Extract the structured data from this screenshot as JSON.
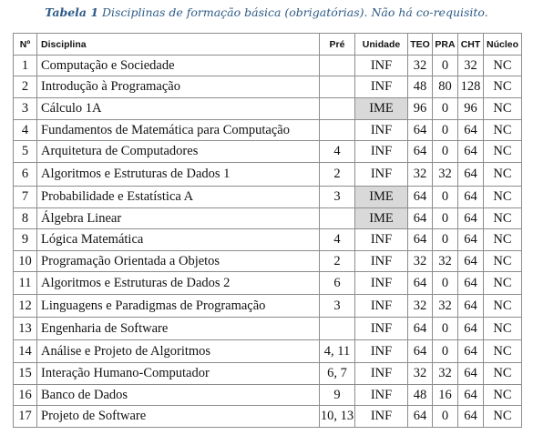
{
  "caption": {
    "label": "Tabela 1",
    "text": " Disciplinas de formação básica (obrigatórias). Não há co-requisito."
  },
  "table": {
    "headers": [
      "Nº",
      "Disciplina",
      "Pré",
      "Unidade",
      "TEO",
      "PRA",
      "CHT",
      "Núcleo"
    ],
    "rows": [
      {
        "n": "1",
        "disciplina": "Computação e Sociedade",
        "pre": "",
        "unidade": "INF",
        "teo": "32",
        "pra": "0",
        "cht": "32",
        "nucleo": "NC",
        "highlight": false
      },
      {
        "n": "2",
        "disciplina": "Introdução à Programação",
        "pre": "",
        "unidade": "INF",
        "teo": "48",
        "pra": "80",
        "cht": "128",
        "nucleo": "NC",
        "highlight": false
      },
      {
        "n": "3",
        "disciplina": "Cálculo 1A",
        "pre": "",
        "unidade": "IME",
        "teo": "96",
        "pra": "0",
        "cht": "96",
        "nucleo": "NC",
        "highlight": true
      },
      {
        "n": "4",
        "disciplina": "Fundamentos de Matemática para Computação",
        "pre": "",
        "unidade": "INF",
        "teo": "64",
        "pra": "0",
        "cht": "64",
        "nucleo": "NC",
        "highlight": false
      },
      {
        "n": "5",
        "disciplina": "Arquitetura de Computadores",
        "pre": "4",
        "unidade": "INF",
        "teo": "64",
        "pra": "0",
        "cht": "64",
        "nucleo": "NC",
        "highlight": false
      },
      {
        "n": "6",
        "disciplina": "Algoritmos e Estruturas de Dados 1",
        "pre": "2",
        "unidade": "INF",
        "teo": "32",
        "pra": "32",
        "cht": "64",
        "nucleo": "NC",
        "highlight": false
      },
      {
        "n": "7",
        "disciplina": "Probabilidade e Estatística A",
        "pre": "3",
        "unidade": "IME",
        "teo": "64",
        "pra": "0",
        "cht": "64",
        "nucleo": "NC",
        "highlight": true
      },
      {
        "n": "8",
        "disciplina": "Álgebra Linear",
        "pre": "",
        "unidade": "IME",
        "teo": "64",
        "pra": "0",
        "cht": "64",
        "nucleo": "NC",
        "highlight": true
      },
      {
        "n": "9",
        "disciplina": "Lógica Matemática",
        "pre": "4",
        "unidade": "INF",
        "teo": "64",
        "pra": "0",
        "cht": "64",
        "nucleo": "NC",
        "highlight": false
      },
      {
        "n": "10",
        "disciplina": "Programação Orientada a Objetos",
        "pre": "2",
        "unidade": "INF",
        "teo": "32",
        "pra": "32",
        "cht": "64",
        "nucleo": "NC",
        "highlight": false
      },
      {
        "n": "11",
        "disciplina": "Algoritmos e Estruturas de Dados 2",
        "pre": "6",
        "unidade": "INF",
        "teo": "64",
        "pra": "0",
        "cht": "64",
        "nucleo": "NC",
        "highlight": false
      },
      {
        "n": "12",
        "disciplina": "Linguagens e Paradigmas de Programação",
        "pre": "3",
        "unidade": "INF",
        "teo": "32",
        "pra": "32",
        "cht": "64",
        "nucleo": "NC",
        "highlight": false
      },
      {
        "n": "13",
        "disciplina": "Engenharia de Software",
        "pre": "",
        "unidade": "INF",
        "teo": "64",
        "pra": "0",
        "cht": "64",
        "nucleo": "NC",
        "highlight": false
      },
      {
        "n": "14",
        "disciplina": "Análise e Projeto de Algoritmos",
        "pre": "4, 11",
        "unidade": "INF",
        "teo": "64",
        "pra": "0",
        "cht": "64",
        "nucleo": "NC",
        "highlight": false
      },
      {
        "n": "15",
        "disciplina": "Interação Humano-Computador",
        "pre": "6, 7",
        "unidade": "INF",
        "teo": "32",
        "pra": "32",
        "cht": "64",
        "nucleo": "NC",
        "highlight": false
      },
      {
        "n": "16",
        "disciplina": "Banco de Dados",
        "pre": "9",
        "unidade": "INF",
        "teo": "48",
        "pra": "16",
        "cht": "64",
        "nucleo": "NC",
        "highlight": false
      },
      {
        "n": "17",
        "disciplina": "Projeto de Software",
        "pre": "10, 13",
        "unidade": "INF",
        "teo": "64",
        "pra": "0",
        "cht": "64",
        "nucleo": "NC",
        "highlight": false
      }
    ]
  }
}
